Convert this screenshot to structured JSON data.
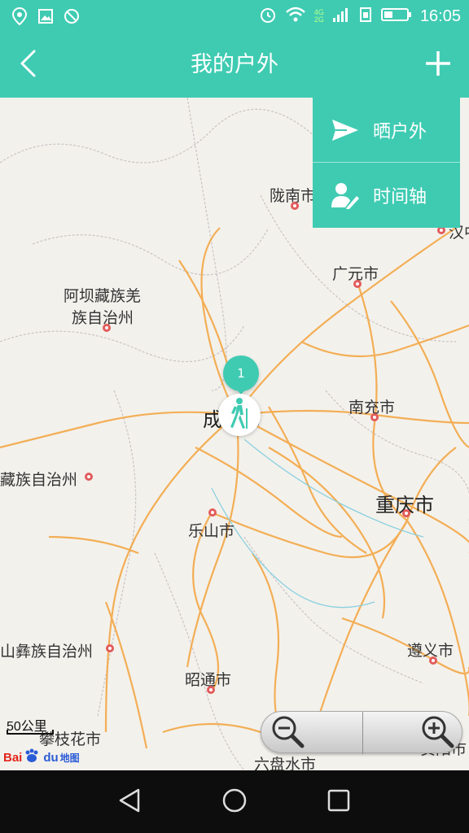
{
  "status_bar": {
    "time": "16:05",
    "network_top": "4G",
    "network_bottom": "2G",
    "icons": [
      "location-icon",
      "image-icon",
      "blocked-icon",
      "alarm-icon",
      "wifi-icon",
      "signal-icon",
      "sim-icon",
      "battery-icon"
    ]
  },
  "app_bar": {
    "title": "我的户外",
    "back_icon": "chevron-left-icon",
    "add_icon": "plus-icon"
  },
  "dropdown_menu": {
    "items": [
      {
        "label": "晒户外",
        "icon": "send-icon"
      },
      {
        "label": "时间轴",
        "icon": "user-edit-icon"
      }
    ]
  },
  "map": {
    "cities": [
      {
        "label": "陇南市"
      },
      {
        "label": "广元市"
      },
      {
        "label": "阿坝藏族羌"
      },
      {
        "label": "族自治州"
      },
      {
        "label": "南充市"
      },
      {
        "label": "成都市"
      },
      {
        "label": "藏族自治州"
      },
      {
        "label": "重庆市"
      },
      {
        "label": "乐山市"
      },
      {
        "label": "遵义市"
      },
      {
        "label": "山彝族自治州"
      },
      {
        "label": "昭通市"
      },
      {
        "label": "攀枝花市"
      },
      {
        "label": "六盘水市"
      },
      {
        "label": "汉中"
      },
      {
        "label": "贵阳市"
      }
    ],
    "cluster_count": "1",
    "marker_icon": "hiker-icon",
    "scale_label": "50公里",
    "logo": {
      "bai": "Bai",
      "du": "du",
      "ditu": "地图"
    },
    "zoom": {
      "out_icon": "zoom-out-icon",
      "in_icon": "zoom-in-icon"
    }
  },
  "nav_bar": {
    "icons": [
      "back-triangle-icon",
      "home-circle-icon",
      "recents-square-icon"
    ]
  },
  "colors": {
    "accent": "#3fcbb2",
    "road": "#f3a33b",
    "map_bg": "#f3f1ec",
    "navbar": "#0d0d0d"
  }
}
